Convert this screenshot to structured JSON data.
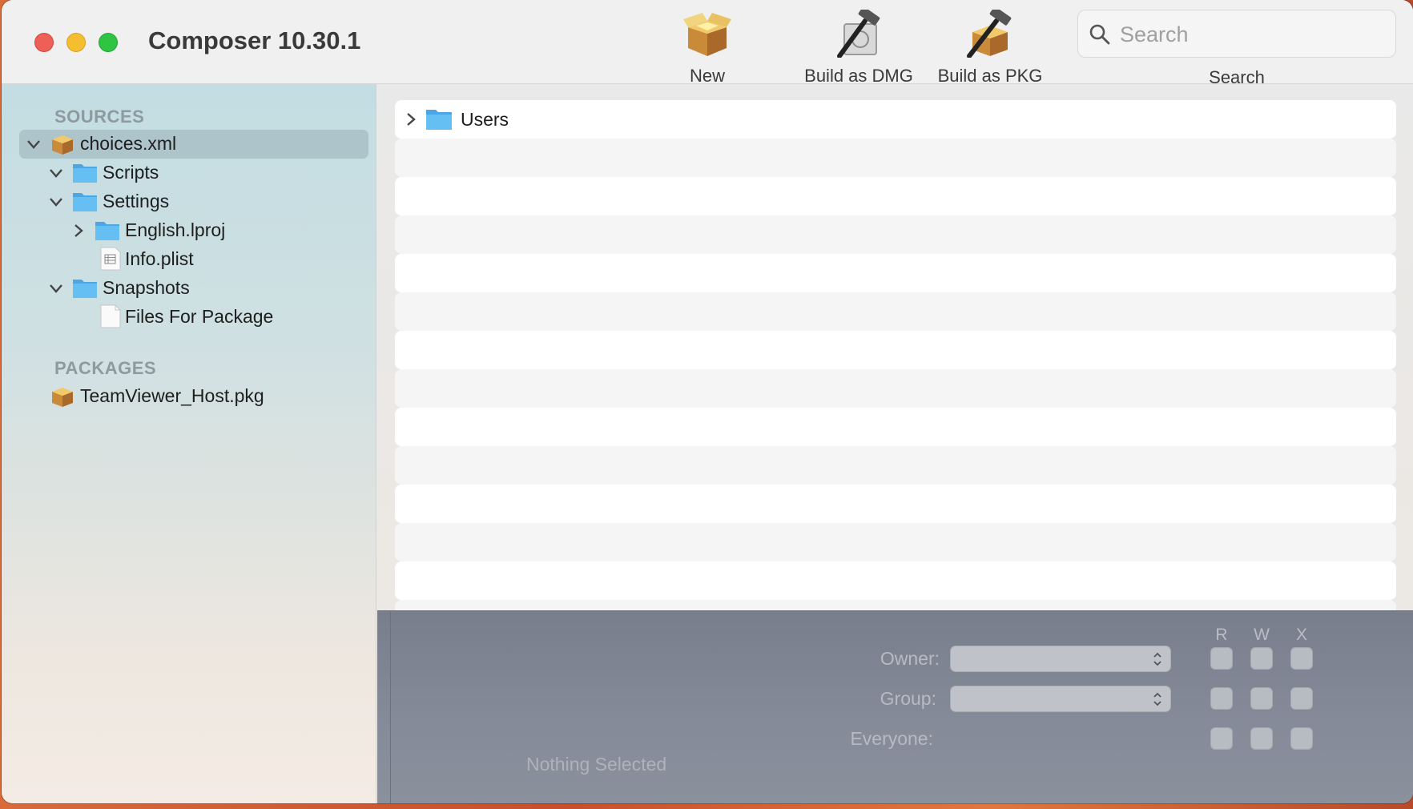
{
  "window": {
    "title": "Composer 10.30.1"
  },
  "toolbar": {
    "new_label": "New",
    "build_dmg_label": "Build as DMG",
    "build_pkg_label": "Build as PKG",
    "search_placeholder": "Search",
    "search_label": "Search"
  },
  "sidebar": {
    "sources_heading": "SOURCES",
    "packages_heading": "PACKAGES",
    "sources": [
      {
        "label": "choices.xml",
        "icon": "package-icon",
        "expanded": true,
        "selected": true
      },
      {
        "label": "Scripts",
        "icon": "folder-icon",
        "expanded": true
      },
      {
        "label": "Settings",
        "icon": "folder-icon",
        "expanded": true
      },
      {
        "label": "English.lproj",
        "icon": "folder-icon",
        "expanded": false
      },
      {
        "label": "Info.plist",
        "icon": "plist-file-icon"
      },
      {
        "label": "Snapshots",
        "icon": "folder-icon",
        "expanded": true
      },
      {
        "label": "Files For Package",
        "icon": "blank-file-icon"
      }
    ],
    "packages": [
      {
        "label": "TeamViewer_Host.pkg",
        "icon": "package-icon"
      }
    ]
  },
  "main": {
    "rows": [
      {
        "label": "Users",
        "icon": "folder-icon",
        "expanded": false
      }
    ]
  },
  "permissions": {
    "columns": [
      "R",
      "W",
      "X"
    ],
    "owner_label": "Owner:",
    "group_label": "Group:",
    "everyone_label": "Everyone:",
    "status": "Nothing Selected"
  },
  "colors": {
    "folder": "#5ab4ec",
    "selection": "#9fb1b8",
    "close": "#ed5f57",
    "minimize": "#f5bd30",
    "maximize": "#2fc542"
  }
}
